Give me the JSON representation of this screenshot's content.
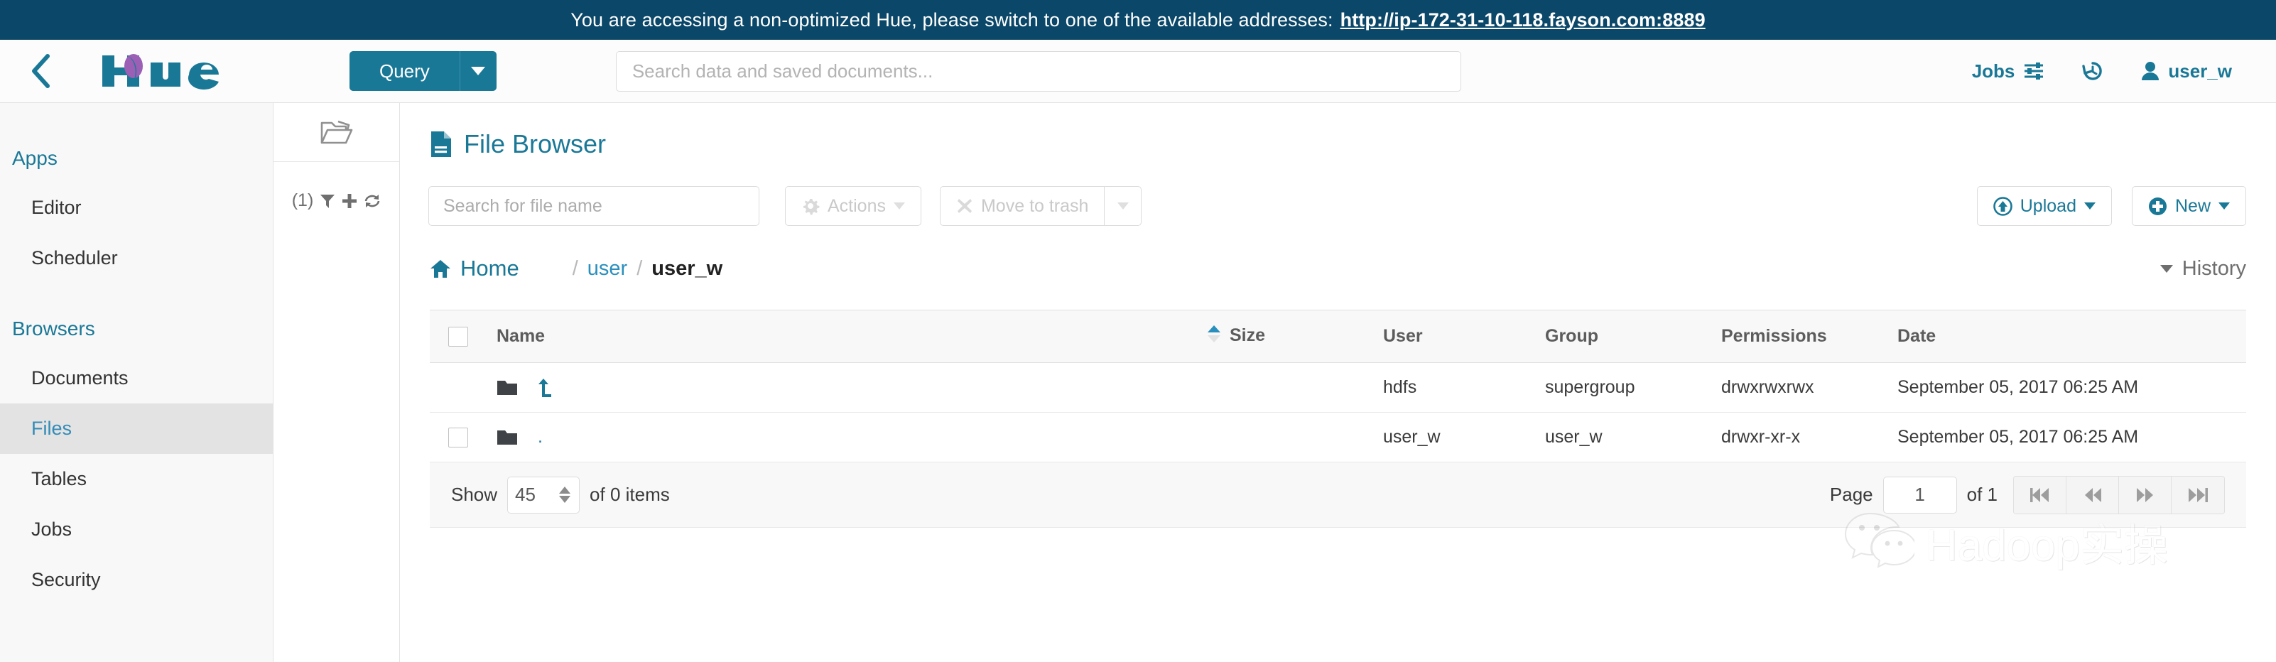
{
  "banner": {
    "message": "You are accessing a non-optimized Hue, please switch to one of the available addresses:",
    "url": "http://ip-172-31-10-118.fayson.com:8889",
    "bg_color": "#0b4768"
  },
  "navbar": {
    "back_icon": "chevron-left-icon",
    "logo_text": "hue",
    "query_label": "Query",
    "query_caret_icon": "caret-down-icon",
    "search_placeholder": "Search data and saved documents...",
    "search_value": "",
    "jobs_label": "Jobs",
    "jobs_icon": "sliders-icon",
    "history_icon": "clock-rotate-left-icon",
    "user_label": "user_w",
    "user_icon": "user-icon",
    "accent_color": "#1a7897"
  },
  "sidebar": {
    "sections": [
      {
        "title": "Apps",
        "items": [
          {
            "label": "Editor",
            "active": false
          },
          {
            "label": "Scheduler",
            "active": false
          }
        ]
      },
      {
        "title": "Browsers",
        "items": [
          {
            "label": "Documents",
            "active": false
          },
          {
            "label": "Files",
            "active": true
          },
          {
            "label": "Tables",
            "active": false
          },
          {
            "label": "Jobs",
            "active": false
          },
          {
            "label": "Security",
            "active": false
          }
        ]
      }
    ]
  },
  "assist": {
    "folder_icon": "folder-open-icon",
    "count_label": "(1)",
    "filter_icon": "filter-icon",
    "add_icon": "plus-icon",
    "refresh_icon": "refresh-icon"
  },
  "main": {
    "title": "File Browser",
    "title_icon": "file-document-icon",
    "toolbar": {
      "search_placeholder": "Search for file name",
      "search_value": "",
      "actions_label": "Actions",
      "actions_icon": "gear-icon",
      "actions_disabled": true,
      "trash_label": "Move to trash",
      "trash_icon": "close-x-icon",
      "trash_disabled": true,
      "trash_caret_icon": "caret-down-icon",
      "upload_label": "Upload",
      "upload_icon": "upload-circle-icon",
      "new_label": "New",
      "new_icon": "plus-circle-icon"
    },
    "breadcrumb": {
      "home_label": "Home",
      "home_icon": "home-icon",
      "separator": "/",
      "parts": [
        "user"
      ],
      "current": "user_w",
      "history_label": "History",
      "history_caret_icon": "caret-down-icon"
    },
    "table": {
      "columns": [
        "Name",
        "Size",
        "User",
        "Group",
        "Permissions",
        "Date"
      ],
      "sort_column": "Name",
      "sort_direction": "asc",
      "rows": [
        {
          "checkbox": false,
          "icon": "folder-icon",
          "name_icon": "arrow-up-parent-icon",
          "name": "",
          "size": "",
          "user": "hdfs",
          "group": "supergroup",
          "permissions": "drwxrwxrwx",
          "date": "September 05, 2017 06:25 AM"
        },
        {
          "checkbox": true,
          "icon": "folder-icon",
          "name_icon": "",
          "name": ".",
          "size": "",
          "user": "user_w",
          "group": "user_w",
          "permissions": "drwxr-xr-x",
          "date": "September 05, 2017 06:25 AM"
        }
      ]
    },
    "footer": {
      "show_label": "Show",
      "show_value": "45",
      "of_items_label": "of 0 items",
      "page_label": "Page",
      "page_value": "1",
      "of_pages_label": "of 1",
      "first_icon": "step-backward-icon",
      "prev_icon": "backward-icon",
      "next_icon": "forward-icon",
      "last_icon": "step-forward-icon"
    }
  },
  "watermark": {
    "icon": "wechat-icon",
    "text": "Hadoop实操"
  }
}
